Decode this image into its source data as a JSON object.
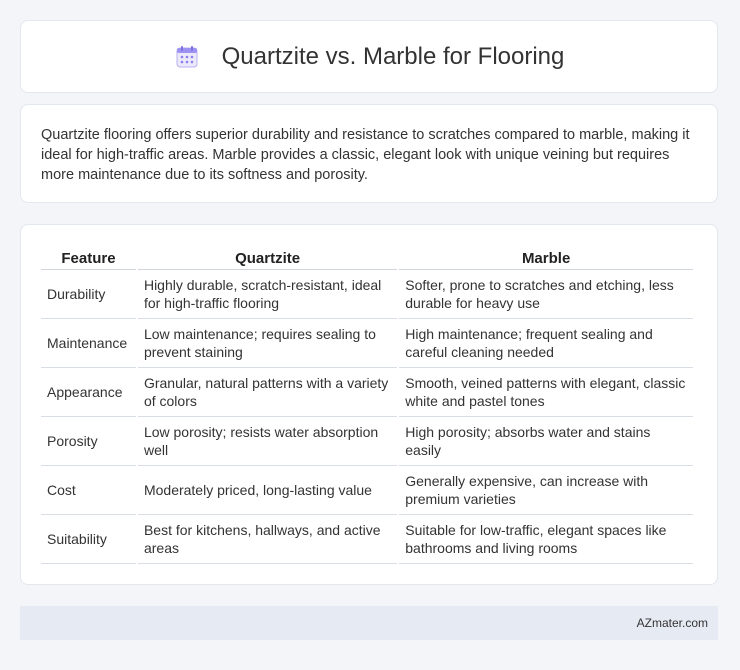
{
  "header": {
    "title": "Quartzite vs. Marble for Flooring",
    "icon": "calendar-icon"
  },
  "summary": {
    "text": "Quartzite flooring offers superior durability and resistance to scratches compared to marble, making it ideal for high-traffic areas. Marble provides a classic, elegant look with unique veining but requires more maintenance due to its softness and porosity."
  },
  "table": {
    "headers": [
      "Feature",
      "Quartzite",
      "Marble"
    ],
    "rows": [
      [
        "Durability",
        "Highly durable, scratch-resistant, ideal for high-traffic flooring",
        "Softer, prone to scratches and etching, less durable for heavy use"
      ],
      [
        "Maintenance",
        "Low maintenance; requires sealing to prevent staining",
        "High maintenance; frequent sealing and careful cleaning needed"
      ],
      [
        "Appearance",
        "Granular, natural patterns with a variety of colors",
        "Smooth, veined patterns with elegant, classic white and pastel tones"
      ],
      [
        "Porosity",
        "Low porosity; resists water absorption well",
        "High porosity; absorbs water and stains easily"
      ],
      [
        "Cost",
        "Moderately priced, long-lasting value",
        "Generally expensive, can increase with premium varieties"
      ],
      [
        "Suitability",
        "Best for kitchens, hallways, and active areas",
        "Suitable for low-traffic, elegant spaces like bathrooms and living rooms"
      ]
    ]
  },
  "footer": {
    "text": "AZmater.com"
  },
  "colors": {
    "background": "#f3f5f8",
    "card": "#ffffff",
    "footer_bg": "#e6ebf3",
    "icon_accent": "#8b7ff0"
  }
}
